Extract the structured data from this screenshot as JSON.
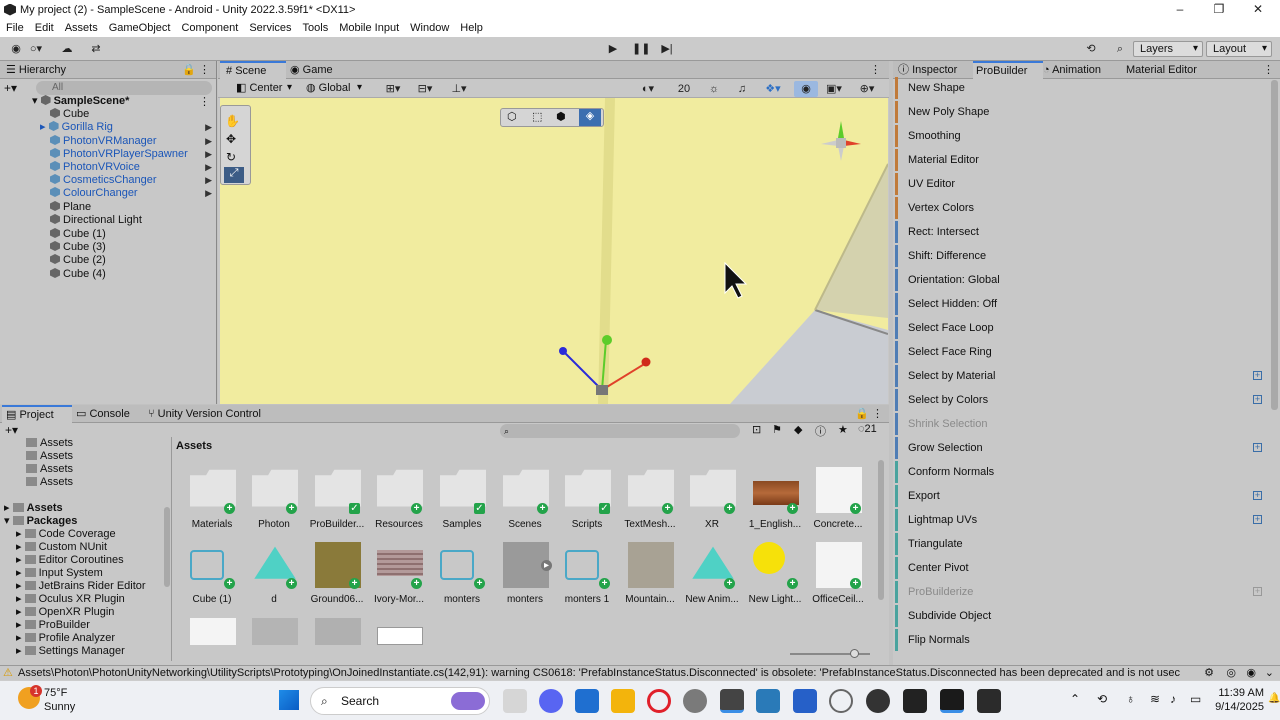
{
  "window": {
    "title": "My project (2) - SampleScene - Android - Unity 2022.3.59f1* <DX11>"
  },
  "menu": [
    "File",
    "Edit",
    "Assets",
    "GameObject",
    "Component",
    "Services",
    "Tools",
    "Mobile Input",
    "Window",
    "Help"
  ],
  "toolbar": {
    "layers": "Layers",
    "layout": "Layout"
  },
  "hierarchy": {
    "tab": "Hierarchy",
    "search_placeholder": "All",
    "scene": "SampleScene*",
    "items": [
      "Cube",
      "Gorilla Rig",
      "PhotonVRManager",
      "PhotonVRPlayerSpawner",
      "PhotonVRVoice",
      "CosmeticsChanger",
      "ColourChanger",
      "Plane",
      "Directional Light",
      "Cube (1)",
      "Cube (3)",
      "Cube (2)",
      "Cube (4)"
    ]
  },
  "scene_view": {
    "tabs": [
      "Scene",
      "Game"
    ],
    "pivot": "Center",
    "space": "Global",
    "grid_size": "20"
  },
  "inspector": {
    "tabs": [
      "Inspector",
      "ProBuilder",
      "Animation",
      "Material Editor"
    ],
    "probuilder_items": [
      "New Shape",
      "New Poly Shape",
      "Smoothing",
      "Material Editor",
      "UV Editor",
      "Vertex Colors",
      "Rect: Intersect",
      "Shift: Difference",
      "Orientation: Global",
      "Select Hidden: Off",
      "Select Face Loop",
      "Select Face Ring",
      "Select by Material",
      "Select by Colors",
      "Shrink Selection",
      "Grow Selection",
      "Conform Normals",
      "Export",
      "Lightmap UVs",
      "Triangulate",
      "Center Pivot",
      "ProBuilderize",
      "Subdivide Object",
      "Flip Normals"
    ]
  },
  "project": {
    "tabs": [
      "Project",
      "Console",
      "Unity Version Control"
    ],
    "count": "21",
    "breadcrumb": "Assets",
    "tree": [
      "Assets",
      "Assets",
      "Assets",
      "Assets",
      "Assets",
      "Packages",
      "Code Coverage",
      "Custom NUnit",
      "Editor Coroutines",
      "Input System",
      "JetBrains Rider Editor",
      "Oculus XR Plugin",
      "OpenXR Plugin",
      "ProBuilder",
      "Profile Analyzer",
      "Settings Manager"
    ],
    "assets_row1": [
      "Materials",
      "Photon",
      "ProBuilder...",
      "Resources",
      "Samples",
      "Scenes",
      "Scripts",
      "TextMesh...",
      "XR",
      "1_English...",
      "Concrete..."
    ],
    "assets_row2": [
      "Cube (1)",
      "d",
      "Ground06...",
      "Ivory-Mor...",
      "monters",
      "monters",
      "monters 1",
      "Mountain...",
      "New Anim...",
      "New Light...",
      "OfficeCeil..."
    ]
  },
  "status": {
    "message": "Assets\\Photon\\PhotonUnityNetworking\\UtilityScripts\\Prototyping\\OnJoinedInstantiate.cs(142,91): warning CS0618: 'PrefabInstanceStatus.Disconnected' is obsolete: 'PrefabInstanceStatus.Disconnected has been deprecated and is not usec"
  },
  "taskbar": {
    "weather_temp": "75°F",
    "weather_desc": "Sunny",
    "weather_badge": "1",
    "search": "Search",
    "time": "11:39 AM",
    "date": "9/14/2025"
  }
}
